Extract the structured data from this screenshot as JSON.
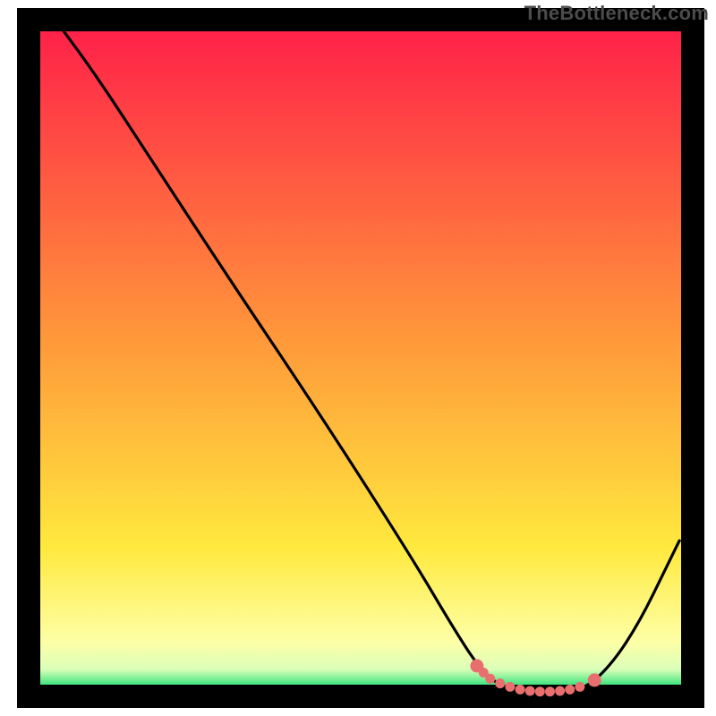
{
  "watermark": "TheBottleneck.com",
  "chart_data": {
    "type": "line",
    "title": "",
    "xlabel": "",
    "ylabel": "",
    "xlim": [
      0,
      100
    ],
    "ylim": [
      0,
      100
    ],
    "background_gradient": {
      "stops": [
        {
          "y_pct": 0,
          "color": "#ff1d49"
        },
        {
          "y_pct": 48,
          "color": "#ff9a3a"
        },
        {
          "y_pct": 78,
          "color": "#ffe93e"
        },
        {
          "y_pct": 92,
          "color": "#fdffa6"
        },
        {
          "y_pct": 96,
          "color": "#dbffb8"
        },
        {
          "y_pct": 98.5,
          "color": "#32e27a"
        },
        {
          "y_pct": 100,
          "color": "#16d66a"
        }
      ]
    },
    "curve_points_percent": [
      {
        "x": 4,
        "y": 100
      },
      {
        "x": 10,
        "y": 92
      },
      {
        "x": 18,
        "y": 80
      },
      {
        "x": 30,
        "y": 62
      },
      {
        "x": 45,
        "y": 40
      },
      {
        "x": 58,
        "y": 20
      },
      {
        "x": 64,
        "y": 10
      },
      {
        "x": 68,
        "y": 4
      },
      {
        "x": 71,
        "y": 1.5
      },
      {
        "x": 75,
        "y": 0.6
      },
      {
        "x": 80,
        "y": 0.6
      },
      {
        "x": 84,
        "y": 1.2
      },
      {
        "x": 88,
        "y": 5
      },
      {
        "x": 92,
        "y": 11
      },
      {
        "x": 96,
        "y": 19
      },
      {
        "x": 98,
        "y": 23
      }
    ],
    "highlight_bottom": {
      "color": "#e96f6f",
      "approx_x_range_pct": [
        67,
        86
      ],
      "approx_y_value_pct": 1.5,
      "points": [
        {
          "x": 67.5,
          "y": 4.5
        },
        {
          "x": 68.5,
          "y": 3.5
        },
        {
          "x": 69.5,
          "y": 2.6
        },
        {
          "x": 71.0,
          "y": 1.9
        },
        {
          "x": 72.5,
          "y": 1.4
        },
        {
          "x": 74.0,
          "y": 1.0
        },
        {
          "x": 75.5,
          "y": 0.8
        },
        {
          "x": 77.0,
          "y": 0.7
        },
        {
          "x": 78.5,
          "y": 0.7
        },
        {
          "x": 80.0,
          "y": 0.8
        },
        {
          "x": 81.5,
          "y": 1.0
        },
        {
          "x": 83.0,
          "y": 1.4
        },
        {
          "x": 85.2,
          "y": 2.4
        }
      ]
    }
  }
}
